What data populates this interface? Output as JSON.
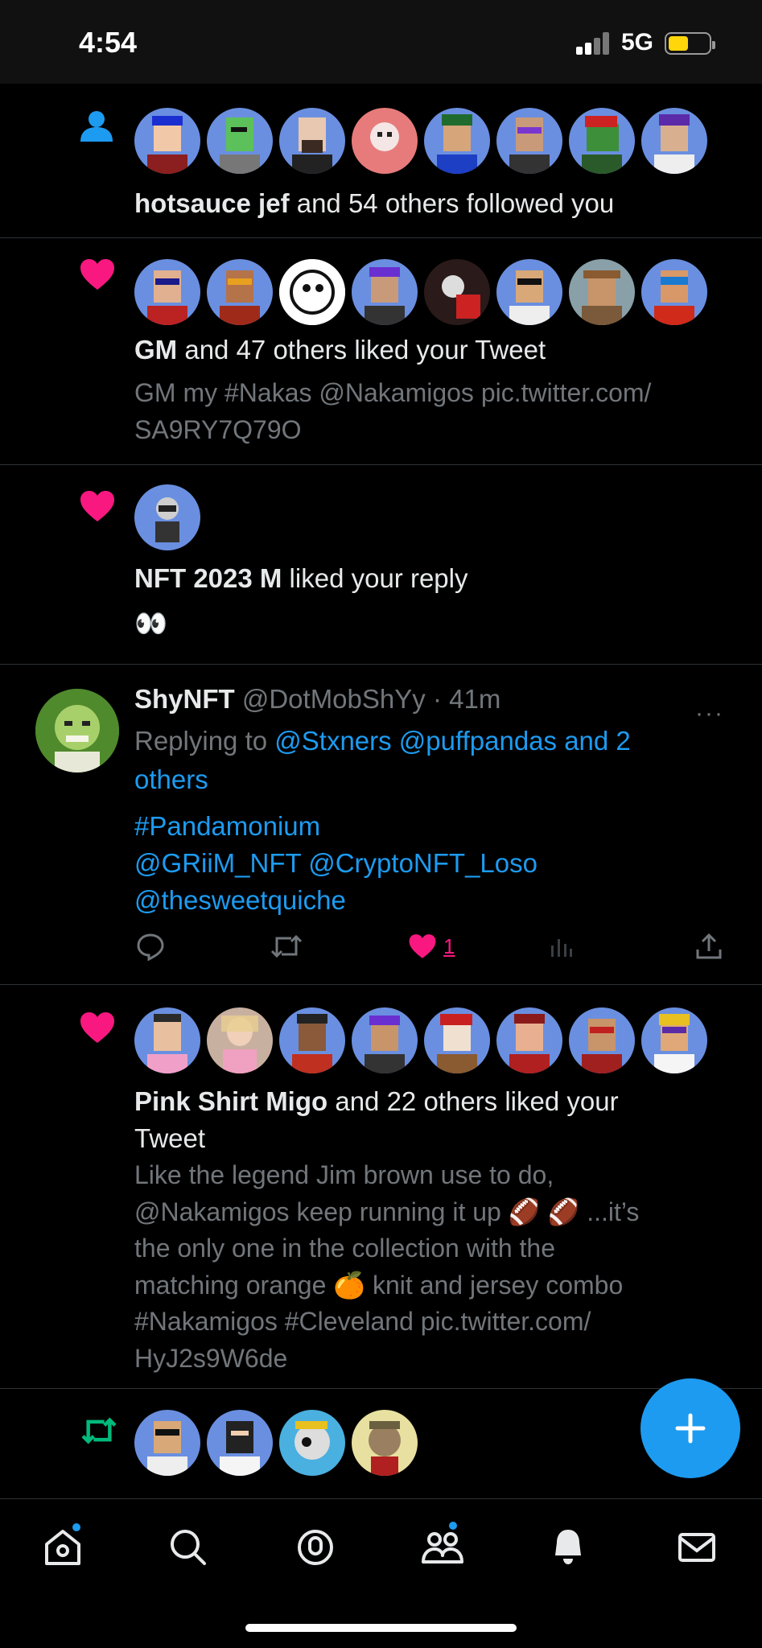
{
  "status": {
    "time": "4:54",
    "network": "5G"
  },
  "notifications": [
    {
      "type": "follow",
      "bold": "hotsauce jef",
      "rest": " and 54 others followed you"
    },
    {
      "type": "like",
      "bold": "GM",
      "rest": " and 47 others liked your Tweet",
      "tweet_line1": "GM my #Nakas @Nakamigos pic.twitter.com/",
      "tweet_line2": "SA9RY7Q79O"
    },
    {
      "type": "like",
      "bold": "NFT 2023 M",
      "rest": " liked your reply",
      "emoji": "👀"
    },
    {
      "type": "like",
      "bold": "Pink Shirt Migo",
      "rest": " and 22 others liked your",
      "rest2": "Tweet",
      "tweet_lines": [
        "Like the legend Jim brown use to do,",
        "@Nakamigos keep running it up 🏈 🏈 ...it’s",
        "the only one in the collection with the",
        "matching orange 🍊  knit and jersey combo",
        "#Nakamigos #Cleveland pic.twitter.com/",
        "HyJ2s9W6de"
      ]
    }
  ],
  "reply": {
    "name": "ShyNFT",
    "handle": "@DotMobShYy",
    "sep": " · ",
    "time": "41m",
    "replying_prefix": "Replying to ",
    "replying_to": "@Stxners @puffpandas and 2",
    "replying_to2": "others",
    "body_line1": "#Pandamonium",
    "body_line2": "@GRiiM_NFT @CryptoNFT_Loso",
    "body_line3": "@thesweetquiche",
    "like_count": "1",
    "more": "···"
  },
  "colors": {
    "accent": "#1d9bf0",
    "like": "#f91880",
    "retweet": "#00ba7c",
    "muted": "#71767b"
  },
  "icons": [
    "person-icon",
    "heart-icon",
    "retweet-icon",
    "reply-icon",
    "views-icon",
    "share-icon",
    "plus-icon",
    "home-icon",
    "search-icon",
    "spaces-icon",
    "communities-icon",
    "bell-icon",
    "mail-icon"
  ]
}
